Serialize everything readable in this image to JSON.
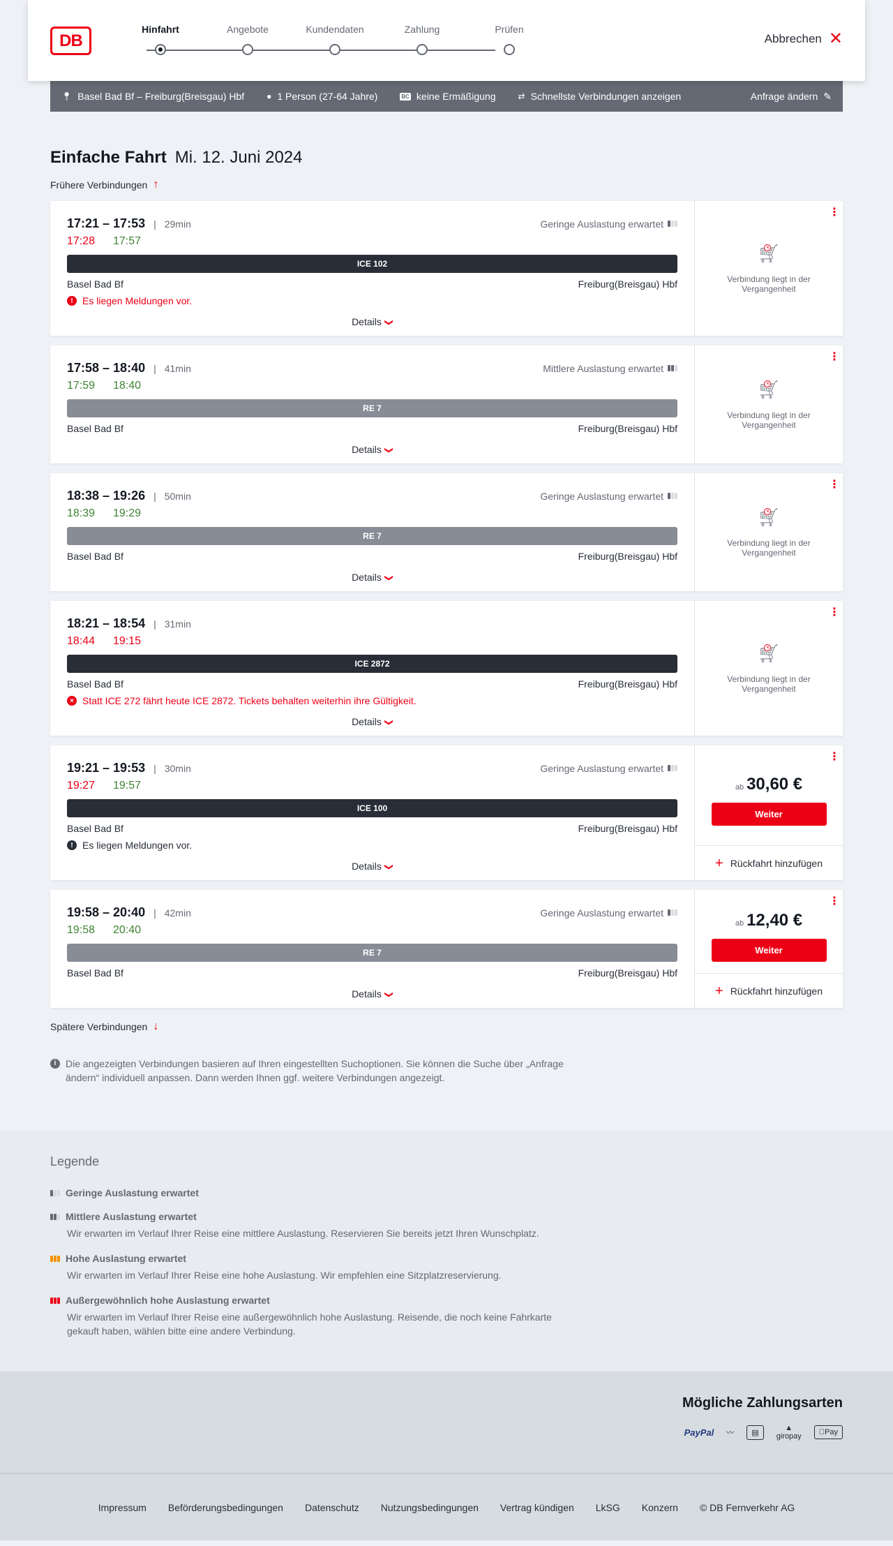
{
  "header": {
    "logo_text": "DB",
    "steps": [
      {
        "label": "Hinfahrt",
        "active": true
      },
      {
        "label": "Angebote",
        "active": false
      },
      {
        "label": "Kundendaten",
        "active": false
      },
      {
        "label": "Zahlung",
        "active": false
      },
      {
        "label": "Prüfen",
        "active": false
      }
    ],
    "cancel_label": "Abbrechen"
  },
  "search": {
    "route": "Basel Bad Bf – Freiburg(Breisgau) Hbf",
    "persons": "1 Person (27-64 Jahre)",
    "bahncard_badge": "BC",
    "discount": "keine Ermäßigung",
    "fastest": "Schnellste Verbindungen anzeigen",
    "change_label": "Anfrage ändern"
  },
  "main": {
    "title": "Einfache Fahrt",
    "date": "Mi. 12. Juni 2024",
    "earlier_label": "Frühere Verbindungen",
    "later_label": "Spätere Verbindungen",
    "details_label": "Details",
    "past_text": "Verbindung liegt in der Vergangenheit",
    "price_prefix": "ab",
    "continue_label": "Weiter",
    "return_label": "Rückfahrt hinzufügen",
    "info_text": "Die angezeigten Verbindungen basieren auf Ihren eingestellten Suchoptionen. Sie können die Suche über „Anfrage ändern“ individuell anpassen. Dann werden Ihnen ggf. weitere Verbindungen angezeigt."
  },
  "connections": [
    {
      "times": "17:21 – 17:53",
      "duration": "29min",
      "occupancy": "Geringe Auslastung erwartet",
      "rt_dep": "17:28",
      "rt_dep_color": "red",
      "rt_arr": "17:57",
      "rt_arr_color": "green",
      "train": "ICE 102",
      "train_style": "dark",
      "from": "Basel Bad Bf",
      "to": "Freiburg(Breisgau) Hbf",
      "message": "Es liegen Meldungen vor.",
      "message_style": "red",
      "message_icon": "!",
      "status": "past"
    },
    {
      "times": "17:58 – 18:40",
      "duration": "41min",
      "occupancy": "Mittlere Auslastung erwartet",
      "rt_dep": "17:59",
      "rt_dep_color": "green",
      "rt_arr": "18:40",
      "rt_arr_color": "green",
      "train": "RE 7",
      "train_style": "gray",
      "from": "Basel Bad Bf",
      "to": "Freiburg(Breisgau) Hbf",
      "message": "",
      "status": "past"
    },
    {
      "times": "18:38 – 19:26",
      "duration": "50min",
      "occupancy": "Geringe Auslastung erwartet",
      "rt_dep": "18:39",
      "rt_dep_color": "green",
      "rt_arr": "19:29",
      "rt_arr_color": "green",
      "train": "RE 7",
      "train_style": "gray",
      "from": "Basel Bad Bf",
      "to": "Freiburg(Breisgau) Hbf",
      "message": "",
      "status": "past"
    },
    {
      "times": "18:21 – 18:54",
      "duration": "31min",
      "occupancy": "",
      "rt_dep": "18:44",
      "rt_dep_color": "red",
      "rt_arr": "19:15",
      "rt_arr_color": "red",
      "train": "ICE 2872",
      "train_style": "dark",
      "from": "Basel Bad Bf",
      "to": "Freiburg(Breisgau) Hbf",
      "message": "Statt ICE 272 fährt heute ICE 2872. Tickets behalten weiterhin ihre Gültigkeit.",
      "message_style": "red",
      "message_icon": "×",
      "status": "past"
    },
    {
      "times": "19:21 – 19:53",
      "duration": "30min",
      "occupancy": "Geringe Auslastung erwartet",
      "rt_dep": "19:27",
      "rt_dep_color": "red",
      "rt_arr": "19:57",
      "rt_arr_color": "green",
      "train": "ICE 100",
      "train_style": "dark",
      "from": "Basel Bad Bf",
      "to": "Freiburg(Breisgau) Hbf",
      "message": "Es liegen Meldungen vor.",
      "message_style": "dark",
      "message_icon": "!",
      "status": "bookable",
      "price": "30,60 €"
    },
    {
      "times": "19:58 – 20:40",
      "duration": "42min",
      "occupancy": "Geringe Auslastung erwartet",
      "rt_dep": "19:58",
      "rt_dep_color": "green",
      "rt_arr": "20:40",
      "rt_arr_color": "green",
      "train": "RE 7",
      "train_style": "gray",
      "from": "Basel Bad Bf",
      "to": "Freiburg(Breisgau) Hbf",
      "message": "",
      "status": "bookable",
      "price": "12,40 €"
    }
  ],
  "legend": {
    "title": "Legende",
    "items": [
      {
        "label": "Geringe Auslastung erwartet",
        "desc": "",
        "level": 1
      },
      {
        "label": "Mittlere Auslastung erwartet",
        "desc": "Wir erwarten im Verlauf Ihrer Reise eine mittlere Auslastung. Reservieren Sie bereits jetzt Ihren Wunschplatz.",
        "level": 2
      },
      {
        "label": "Hohe Auslastung erwartet",
        "desc": "Wir erwarten im Verlauf Ihrer Reise eine hohe Auslastung. Wir empfehlen eine Sitzplatzreservierung.",
        "level": 3
      },
      {
        "label": "Außergewöhnlich hohe Auslastung erwartet",
        "desc": "Wir erwarten im Verlauf Ihrer Reise eine außergewöhnlich hohe Auslastung. Reisende, die noch keine Fahrkarte gekauft haben, wählen bitte eine andere Verbindung.",
        "level": 4
      }
    ]
  },
  "payment": {
    "title": "Mögliche Zahlungsarten",
    "methods": [
      "PayPal",
      "giropay",
      "Pay"
    ]
  },
  "footer": {
    "links": [
      "Impressum",
      "Beförderungsbedingungen",
      "Datenschutz",
      "Nutzungsbedingungen",
      "Vertrag kündigen",
      "LkSG",
      "Konzern",
      "© DB Fernverkehr AG"
    ]
  },
  "colors": {
    "accent": "#ec0016",
    "delay": "#ec0016",
    "ontime": "#408335",
    "bar": "#646973"
  }
}
